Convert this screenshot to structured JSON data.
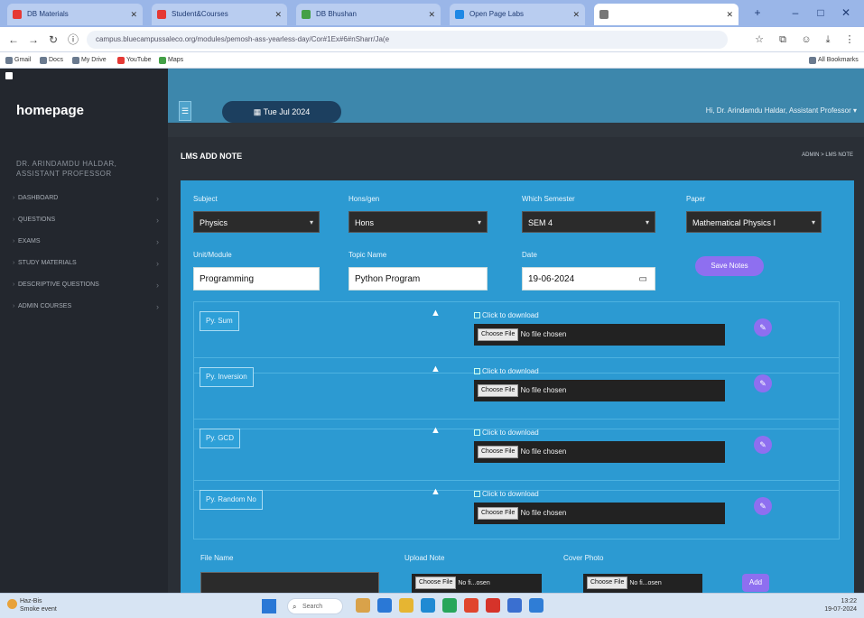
{
  "browser": {
    "tabs": [
      {
        "label": "DB Materials",
        "color": "#e53935",
        "active": false
      },
      {
        "label": "Student&Courses",
        "color": "#e53935",
        "active": false
      },
      {
        "label": "DB Bhushan",
        "color": "#43a047",
        "active": false
      },
      {
        "label": "Open Page Labs",
        "color": "#1e88e5",
        "active": false
      },
      {
        "label": "",
        "color": "#777777",
        "active": true
      }
    ],
    "url": "campus.bluecampussaleco.org/modules/pemosh-ass-yearless-day/Cor#1Ex#6#nSharr/Ja(e",
    "bookmarks": [
      {
        "label": "Gmail"
      },
      {
        "label": "Docs"
      },
      {
        "label": "My Drive"
      },
      {
        "label": "YouTube"
      },
      {
        "label": "Maps"
      },
      {
        "label": "All Bookmarks"
      }
    ]
  },
  "app": {
    "brand": "homepage",
    "date_pill": "Tue Jul 2024",
    "user_menu": "Hi, Dr. Arindamdu Haldar, Assistant Professor",
    "sidebar_user": "DR. ARINDAMDU HALDAR, ASSISTANT PROFESSOR",
    "sidebar_items": [
      {
        "label": "DASHBOARD"
      },
      {
        "label": "QUESTIONS"
      },
      {
        "label": "EXAMS"
      },
      {
        "label": "STUDY MATERIALS"
      },
      {
        "label": "DESCRIPTIVE QUESTIONS"
      },
      {
        "label": "ADMIN COURSES"
      }
    ],
    "page_title": "LMS ADD NOTE",
    "breadcrumb": "ADMIN > LMS NOTE"
  },
  "form": {
    "subject_label": "Subject",
    "subject_value": "Physics",
    "honours_label": "Hons/gen",
    "honours_value": "Hons",
    "semester_label": "Which Semester",
    "semester_value": "SEM 4",
    "paper_label": "Paper",
    "paper_value": "Mathematical Physics I",
    "unit_label": "Unit/Module",
    "unit_value": "Programming",
    "topic_label": "Topic Name",
    "topic_value": "Python Program",
    "date_label": "Date",
    "date_value": "19-06-2024",
    "save_button": "Save Notes",
    "rows": [
      {
        "label": "Py. Sum"
      },
      {
        "label": "Py. Inversion"
      },
      {
        "label": "Py. GCD"
      },
      {
        "label": "Py. Random No"
      }
    ],
    "download_text": "Click to download",
    "choose_file": "Choose File",
    "no_file": "No file chosen",
    "file_name_label": "File Name",
    "upload_note_label": "Upload Note",
    "cover_photo_label": "Cover Photo",
    "no_file_short": "No fi...osen",
    "add_button": "Add"
  },
  "taskbar": {
    "weather_temp": "Haz-Bis",
    "weather_desc": "Smoke event",
    "search_placeholder": "Search",
    "time": "13:22",
    "date": "19-07-2024"
  }
}
